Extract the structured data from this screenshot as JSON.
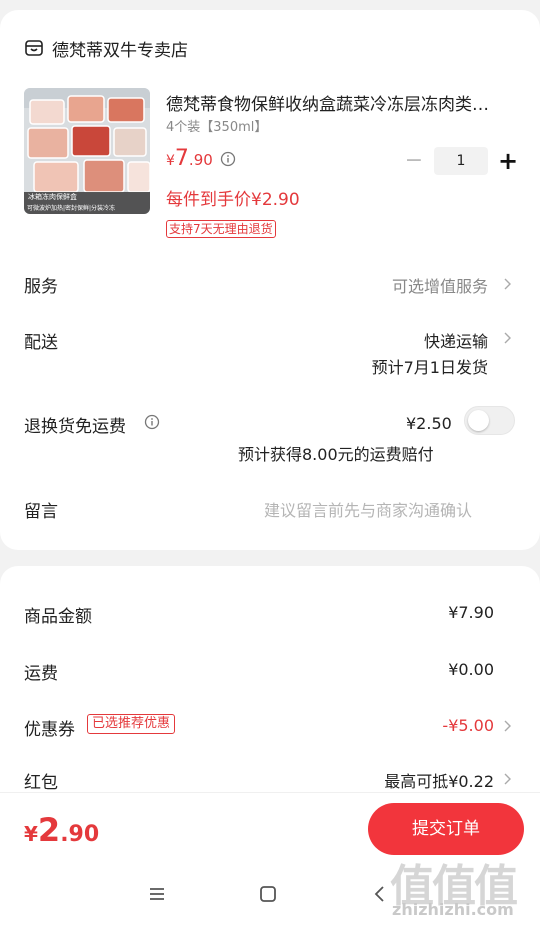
{
  "shop": {
    "name": "德梵蒂双牛专卖店",
    "icon": "shop-icon"
  },
  "product": {
    "title": "德梵蒂食物保鲜收纳盒蔬菜冷冻层冻肉类…",
    "spec": "4个装【350ml】",
    "price_currency": "¥",
    "price_int": "7",
    "price_dec": ".90",
    "per_unit": "每件到手价¥2.90",
    "return_tag": "支持7天无理由退货",
    "thumb_caption": "冰箱冻肉保鲜盒",
    "thumb_features": "可微波炉加热|密封保鲜|分装冷冻",
    "quantity": "1",
    "minus": "−",
    "plus": "+"
  },
  "rows": {
    "service_label": "服务",
    "service_value": "可选增值服务",
    "delivery_label": "配送",
    "delivery_value": "快递运输",
    "delivery_date": "预计7月1日发货",
    "return_label": "退换货免运费",
    "return_price": "¥2.50",
    "return_note": "预计获得8.00元的运费赔付",
    "return_toggle_on": false,
    "message_label": "留言",
    "message_placeholder": "建议留言前先与商家沟通确认"
  },
  "summary": {
    "goods_label": "商品金额",
    "goods_value": "¥7.90",
    "shipping_label": "运费",
    "shipping_value": "¥0.00",
    "coupon_label": "优惠券",
    "coupon_tag": "已选推荐优惠",
    "coupon_value": "-¥5.00",
    "redpacket_label": "红包",
    "redpacket_value": "最高可抵¥0.22"
  },
  "bottom": {
    "total_currency": "¥",
    "total_int": "2",
    "total_dec": ".90",
    "submit": "提交订单"
  },
  "watermark": {
    "glyphs": "值值值",
    "url": "zhizhizhi.com"
  },
  "colors": {
    "accent": "#e4393c",
    "submit_bg": "#f2353c",
    "muted": "#888888"
  }
}
